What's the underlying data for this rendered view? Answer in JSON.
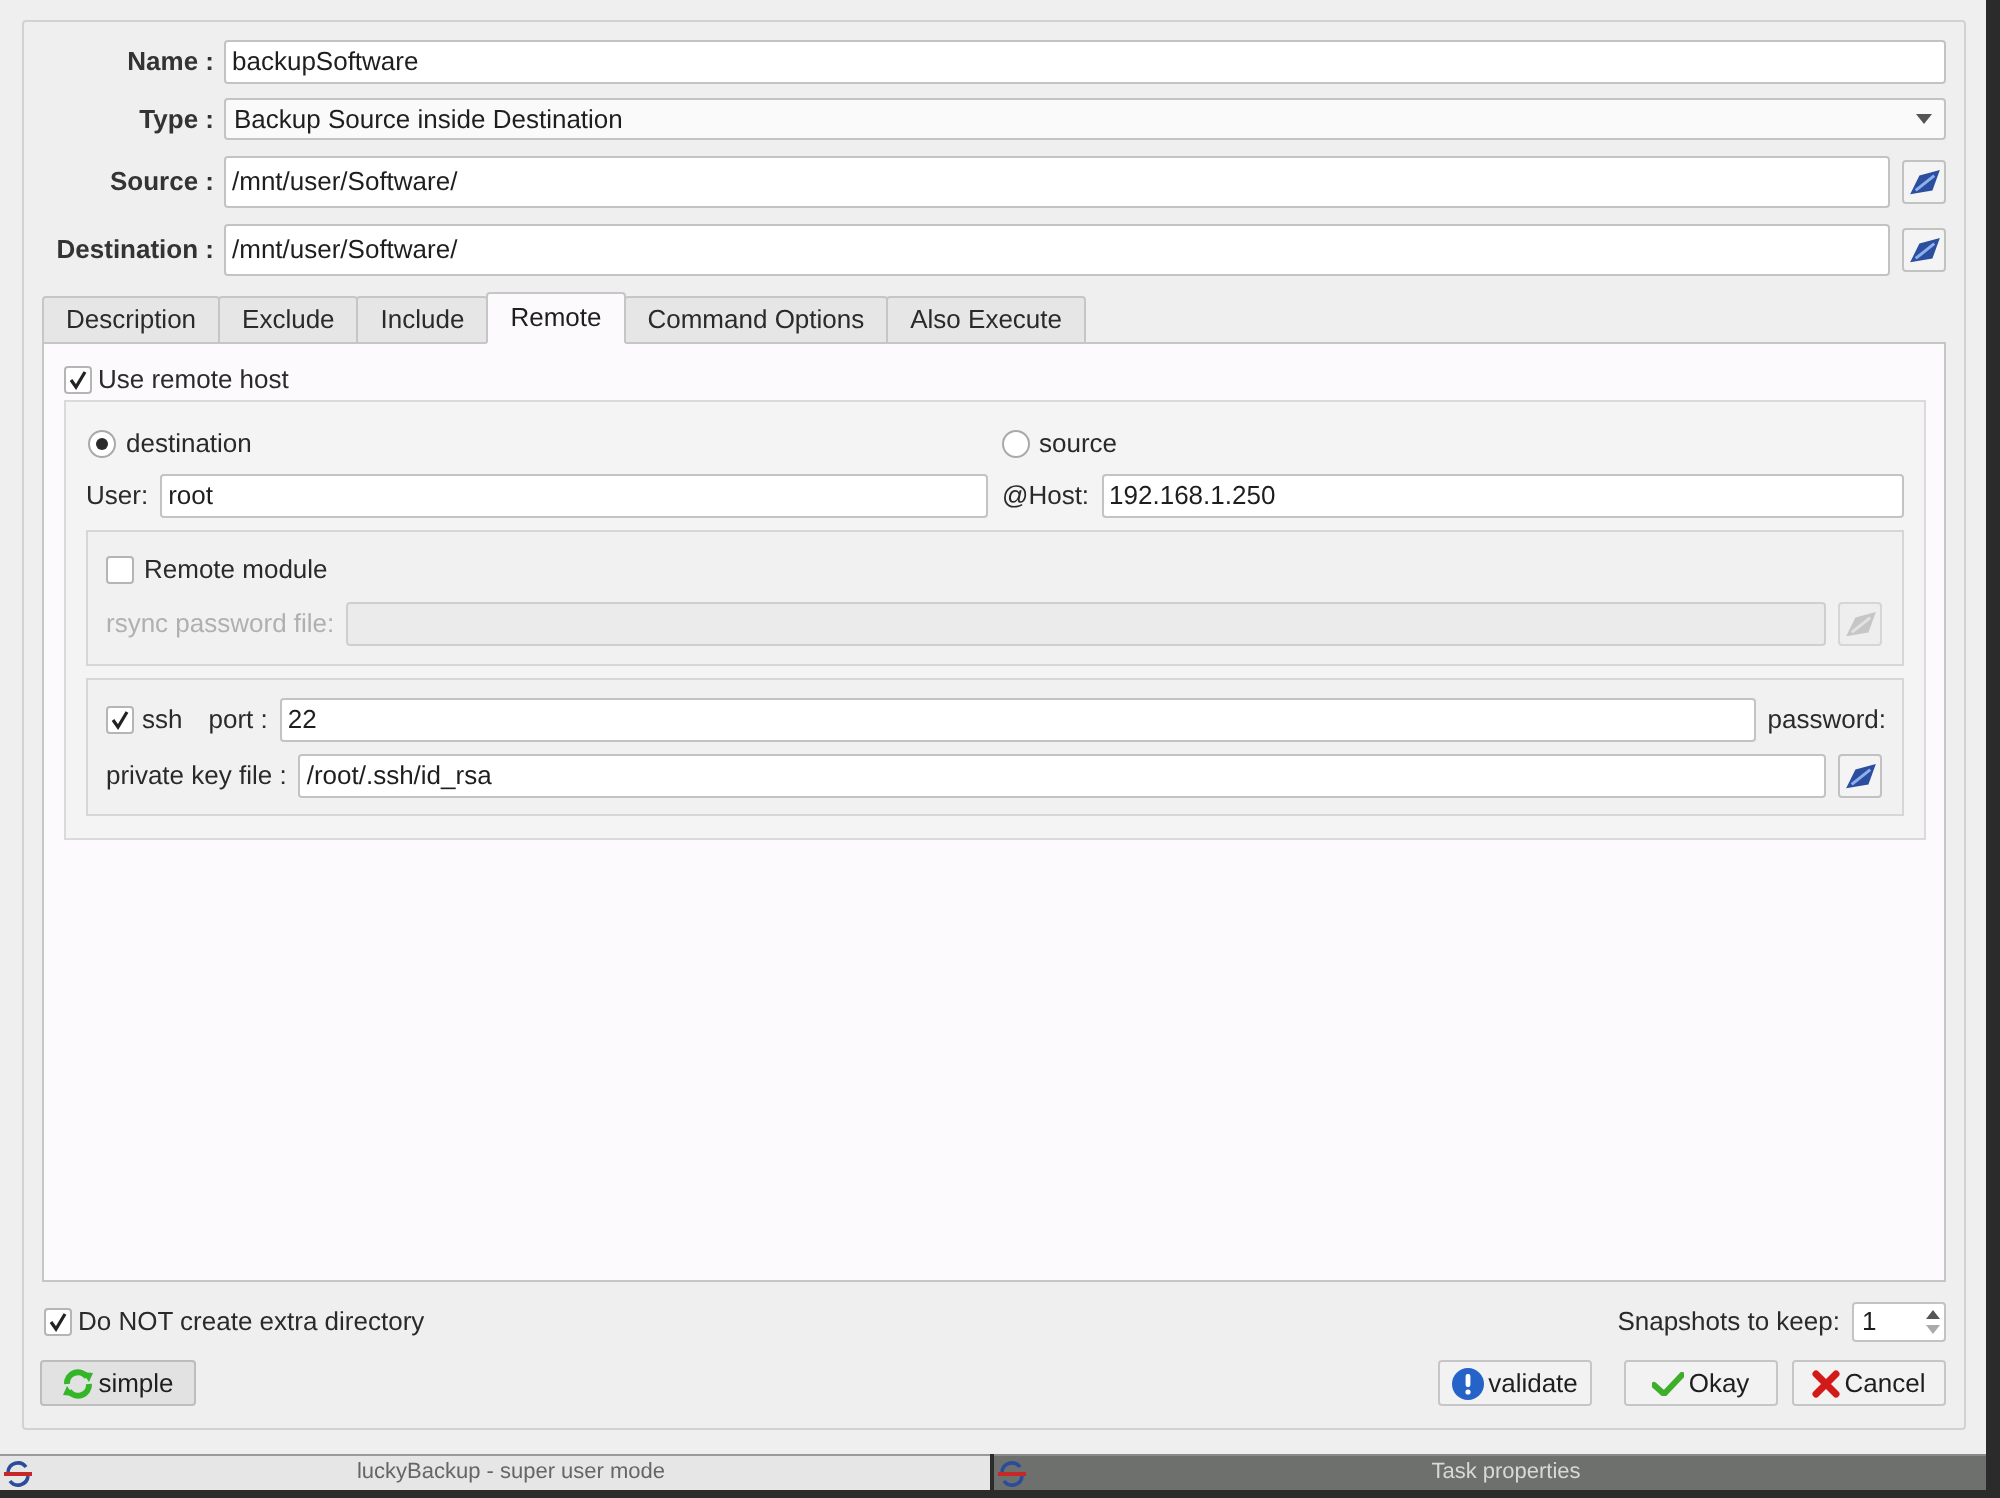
{
  "form": {
    "fields": [
      {
        "label": "Name :",
        "value": "backupSoftware",
        "kind": "text"
      },
      {
        "label": "Type :",
        "value": "Backup Source inside Destination",
        "kind": "combo"
      },
      {
        "label": "Source :",
        "value": "/mnt/user/Software/",
        "kind": "path"
      },
      {
        "label": "Destination :",
        "value": "/mnt/user/Software/",
        "kind": "path"
      }
    ]
  },
  "tabs": [
    {
      "label": "Description",
      "selected": false
    },
    {
      "label": "Exclude",
      "selected": false
    },
    {
      "label": "Include",
      "selected": false
    },
    {
      "label": "Remote",
      "selected": true
    },
    {
      "label": "Command Options",
      "selected": false
    },
    {
      "label": "Also Execute",
      "selected": false
    }
  ],
  "remote": {
    "use_remote_host": {
      "label": "Use remote host",
      "checked": true
    },
    "direction": [
      {
        "label": "destination",
        "selected": true
      },
      {
        "label": "source",
        "selected": false
      }
    ],
    "user": {
      "label": "User:",
      "value": "root"
    },
    "host": {
      "label": "@Host:",
      "value": "192.168.1.250"
    },
    "remote_module": {
      "label": "Remote module",
      "checked": false
    },
    "rsync_password_file": {
      "label": "rsync password file:",
      "disabled": true
    },
    "ssh": {
      "label": "ssh",
      "checked": true
    },
    "port": {
      "label": "port :",
      "value": "22"
    },
    "password": {
      "label": "password:"
    },
    "private_key_file": {
      "label": "private key file :",
      "value": "/root/.ssh/id_rsa"
    }
  },
  "no_extra_directory": {
    "label": "Do NOT create extra directory",
    "checked": true
  },
  "snapshots": {
    "label": "Snapshots to keep:",
    "value": "1"
  },
  "mode_button": {
    "label": "simple"
  },
  "buttons": [
    {
      "label": "validate",
      "kind": "validate"
    },
    {
      "label": "Okay",
      "kind": "okay"
    },
    {
      "label": "Cancel",
      "kind": "cancel"
    }
  ],
  "taskbar": [
    {
      "title": "luckyBackup - super user mode",
      "selected": false
    },
    {
      "title": "Task properties",
      "selected": true
    }
  ]
}
